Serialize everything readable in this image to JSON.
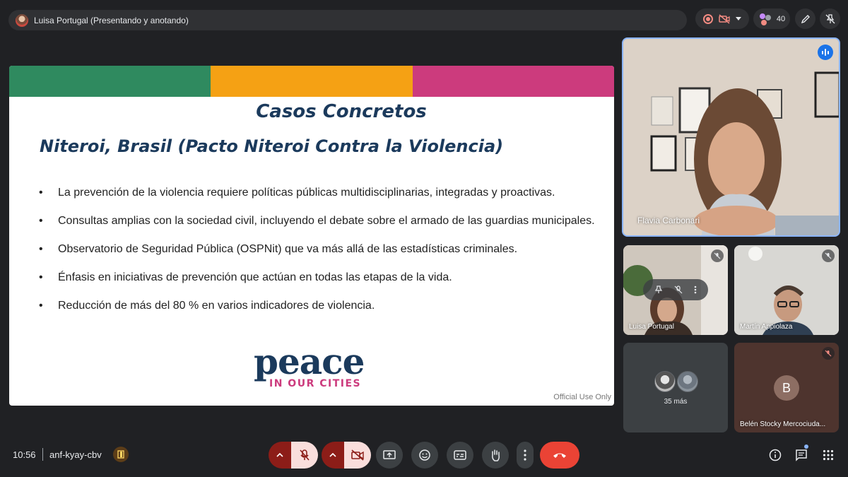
{
  "presenter": {
    "label": "Luisa Portugal (Presentando y anotando)"
  },
  "top_controls": {
    "participant_count": "40"
  },
  "slide": {
    "title": "Casos Concretos",
    "subtitle": "Niteroi, Brasil (Pacto Niteroi Contra la Violencia)",
    "bullets": [
      "La prevención de la violencia requiere políticas públicas multidisciplinarias, integradas y proactivas.",
      "Consultas amplias con la sociedad civil, incluyendo el debate sobre el armado de las guardias municipales.",
      "Observatorio de Seguridad Pública (OSPNit) que va más allá de las estadísticas criminales.",
      "Énfasis en iniciativas de prevención que actúan en todas las etapas de la vida.",
      "Reducción de más del 80 % en varios indicadores de violencia."
    ],
    "logo_main": "peace",
    "logo_sub": "IN OUR CITIES",
    "footer": "Official Use Only",
    "stripe_colors": [
      "#2f8a5f",
      "#f5a114",
      "#cc3b7d"
    ]
  },
  "participants": {
    "main": {
      "name": "Flavia Carbonari"
    },
    "tiles": [
      {
        "name": "Luisa Portugal"
      },
      {
        "name": "Martín Appiolaza"
      },
      {
        "count_label": "35 más"
      },
      {
        "name": "Belén Stocky Mercociuda...",
        "initial": "B"
      }
    ]
  },
  "bottom_bar": {
    "time": "10:56",
    "meeting_code": "anf-kyay-cbv"
  },
  "colors": {
    "background": "#202124",
    "hangup": "#ea4335",
    "muted_fill": "#f9dedc",
    "muted_dark": "#8c1d18",
    "accent_blue": "#8ab4f8"
  }
}
